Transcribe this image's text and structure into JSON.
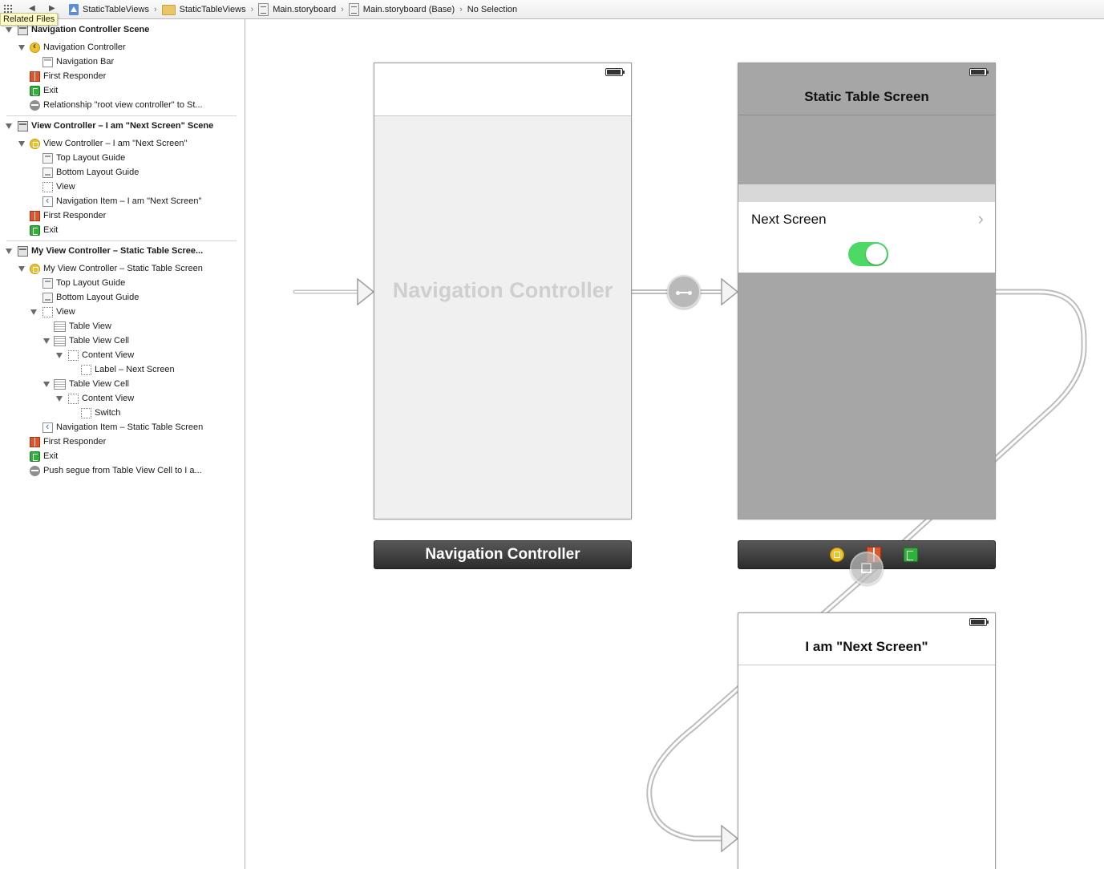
{
  "jumpbar": {
    "tooltip": "Related Files",
    "back_glyph": "◀",
    "forward_glyph": "▶",
    "breadcrumbs": [
      {
        "label": "StaticTableViews",
        "icon": "project-icon"
      },
      {
        "label": "StaticTableViews",
        "icon": "folder-icon"
      },
      {
        "label": "Main.storyboard",
        "icon": "storyboard-icon"
      },
      {
        "label": "Main.storyboard (Base)",
        "icon": "storyboard-icon"
      },
      {
        "label": "No Selection",
        "icon": ""
      }
    ],
    "separator": "›"
  },
  "outline": {
    "rows": [
      "Navigation Controller Scene",
      "Navigation Controller",
      "Navigation Bar",
      "First Responder",
      "Exit",
      "Relationship \"root view controller\" to St...",
      "View Controller – I am \"Next Screen\" Scene",
      "View Controller – I am \"Next Screen\"",
      "Top Layout Guide",
      "Bottom Layout Guide",
      "View",
      "Navigation Item – I am \"Next Screen\"",
      "First Responder",
      "Exit",
      "My View Controller – Static Table Scree...",
      "My View Controller – Static Table Screen",
      "Top Layout Guide",
      "Bottom Layout Guide",
      "View",
      "Table View",
      "Table View Cell",
      "Content View",
      "Label – Next Screen",
      "Table View Cell",
      "Content View",
      "Switch",
      "Navigation Item – Static Table Screen",
      "First Responder",
      "Exit",
      "Push segue from Table View Cell to I a..."
    ]
  },
  "canvas": {
    "nav_controller": {
      "watermark": "Navigation Controller",
      "dock_label": "Navigation Controller"
    },
    "static_table": {
      "nav_title": "Static Table Screen",
      "cell_label": "Next Screen",
      "cell_chevron": "›",
      "switch_on": true
    },
    "next_screen": {
      "nav_title": "I am \"Next Screen\""
    },
    "colors": {
      "switch_on": "#4cd964",
      "dim_overlay": "#a6a6a6",
      "dock_dark": "#3a3a3a",
      "watermark": "#cfcfcf"
    }
  }
}
